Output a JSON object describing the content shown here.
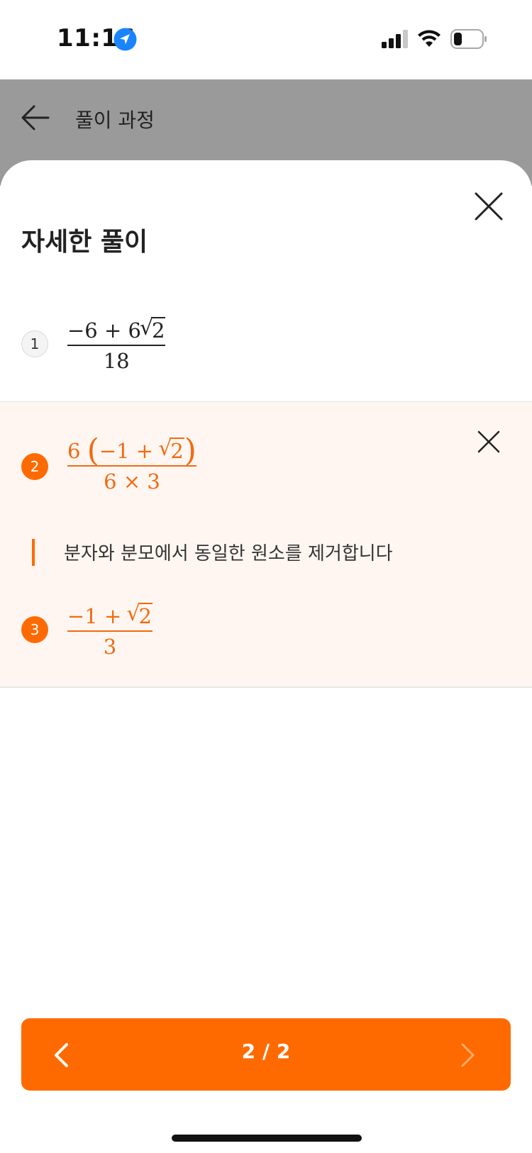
{
  "status_bar": {
    "time": "11:16"
  },
  "header": {
    "title": "풀이 과정"
  },
  "sheet": {
    "title": "자세한 풀이"
  },
  "steps": [
    {
      "number": "1",
      "numerator_a": "−6 + 6",
      "numerator_rad": "2",
      "denominator": "18"
    },
    {
      "number": "2",
      "numerator_coef": "6",
      "paren_open": "(",
      "numerator_inner": "−1 + ",
      "numerator_rad": "2",
      "paren_close": ")",
      "denominator": "6 × 3",
      "explanation": "분자와 분모에서 동일한 원소를 제거합니다"
    },
    {
      "number": "3",
      "numerator_a": "−1 + ",
      "numerator_rad": "2",
      "denominator": "3"
    }
  ],
  "pager": {
    "label": "2 / 2"
  },
  "colors": {
    "accent": "#ff6a00",
    "highlight_bg": "#fff6f1",
    "header_bg": "#9a9a9a"
  }
}
